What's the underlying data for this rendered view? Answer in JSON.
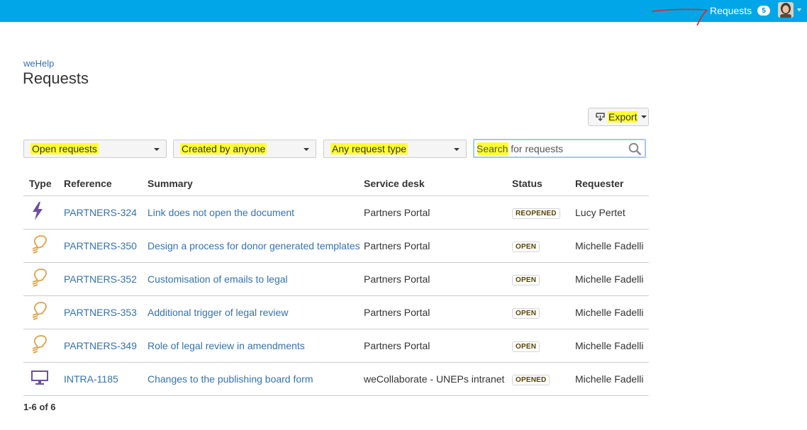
{
  "topbar": {
    "requests_label": "Requests",
    "requests_count": "5",
    "bg_color": "#00a6e8"
  },
  "breadcrumb": "weHelp",
  "page_title": "Requests",
  "export": {
    "label": "Export",
    "icon": "export-icon"
  },
  "filters": {
    "status": "Open requests",
    "creator": "Created by anyone",
    "request_type": "Any request type"
  },
  "search": {
    "placeholder": "Search for requests"
  },
  "table": {
    "headers": [
      "Type",
      "Reference",
      "Summary",
      "Service desk",
      "Status",
      "Requester"
    ],
    "rows": [
      {
        "type_icon": "lightning-icon",
        "reference": "PARTNERS-324",
        "summary": "Link does not open the document",
        "service_desk": "Partners Portal",
        "status": "REOPENED",
        "requester": "Lucy Pertet"
      },
      {
        "type_icon": "lightbulb-icon",
        "reference": "PARTNERS-350",
        "summary": "Design a process for donor generated templates",
        "service_desk": "Partners Portal",
        "status": "OPEN",
        "requester": "Michelle Fadelli"
      },
      {
        "type_icon": "lightbulb-icon",
        "reference": "PARTNERS-352",
        "summary": "Customisation of emails to legal",
        "service_desk": "Partners Portal",
        "status": "OPEN",
        "requester": "Michelle Fadelli"
      },
      {
        "type_icon": "lightbulb-icon",
        "reference": "PARTNERS-353",
        "summary": "Additional trigger of legal review",
        "service_desk": "Partners Portal",
        "status": "OPEN",
        "requester": "Michelle Fadelli"
      },
      {
        "type_icon": "lightbulb-icon",
        "reference": "PARTNERS-349",
        "summary": "Role of legal review in amendments",
        "service_desk": "Partners Portal",
        "status": "OPEN",
        "requester": "Michelle Fadelli"
      },
      {
        "type_icon": "monitor-icon",
        "reference": "INTRA-1185",
        "summary": "Changes to the publishing board form",
        "service_desk": "weCollaborate - UNEPs intranet",
        "status": "OPENED",
        "requester": "Michelle Fadelli"
      }
    ]
  },
  "pagination": "1-6 of 6",
  "colors": {
    "link": "#3572b0",
    "highlight": "#ffff33",
    "lightning": "#6b4fa3",
    "lightbulb": "#e0a048",
    "monitor": "#6b4fa3",
    "status_text": "#594300"
  }
}
